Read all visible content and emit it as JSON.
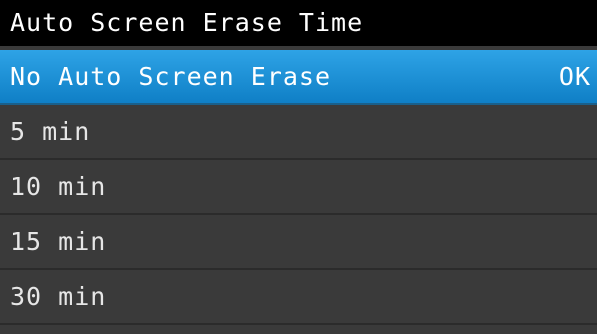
{
  "title": "Auto Screen Erase Time",
  "items": [
    {
      "label": "No Auto Screen Erase",
      "action": "OK"
    },
    {
      "label": "5 min"
    },
    {
      "label": "10 min"
    },
    {
      "label": "15 min"
    },
    {
      "label": "30 min"
    }
  ]
}
